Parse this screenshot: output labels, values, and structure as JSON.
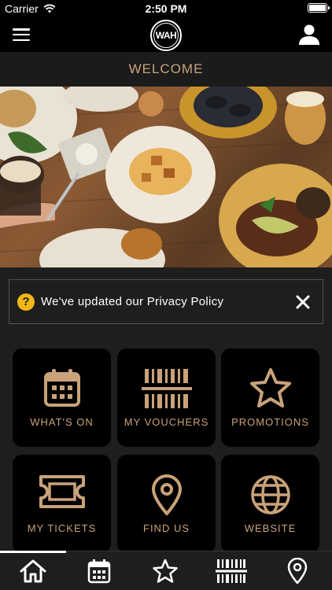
{
  "status_bar": {
    "carrier": "Carrier",
    "time": "2:50 PM"
  },
  "header": {
    "logo_text": "WAH",
    "menu_icon": "hamburger-icon",
    "profile_icon": "user-icon"
  },
  "welcome": {
    "title": "WELCOME"
  },
  "notice": {
    "text": "We've updated our Privacy Policy",
    "icon": "?"
  },
  "tiles": [
    {
      "label": "WHAT'S ON",
      "icon": "calendar-icon"
    },
    {
      "label": "MY VOUCHERS",
      "icon": "barcode-icon"
    },
    {
      "label": "PROMOTIONS",
      "icon": "star-icon"
    },
    {
      "label": "MY TICKETS",
      "icon": "ticket-icon"
    },
    {
      "label": "FIND US",
      "icon": "location-pin-icon"
    },
    {
      "label": "WEBSITE",
      "icon": "globe-icon"
    }
  ],
  "tabbar": [
    {
      "icon": "home-icon",
      "active": true
    },
    {
      "icon": "calendar-icon",
      "active": false
    },
    {
      "icon": "star-icon",
      "active": false
    },
    {
      "icon": "barcode-icon",
      "active": false
    },
    {
      "icon": "location-pin-icon",
      "active": false
    }
  ],
  "colors": {
    "accent": "#c9a27a",
    "tile_bg": "#000000",
    "page_bg": "#1e1e1e",
    "notice_icon": "#f2b616"
  }
}
